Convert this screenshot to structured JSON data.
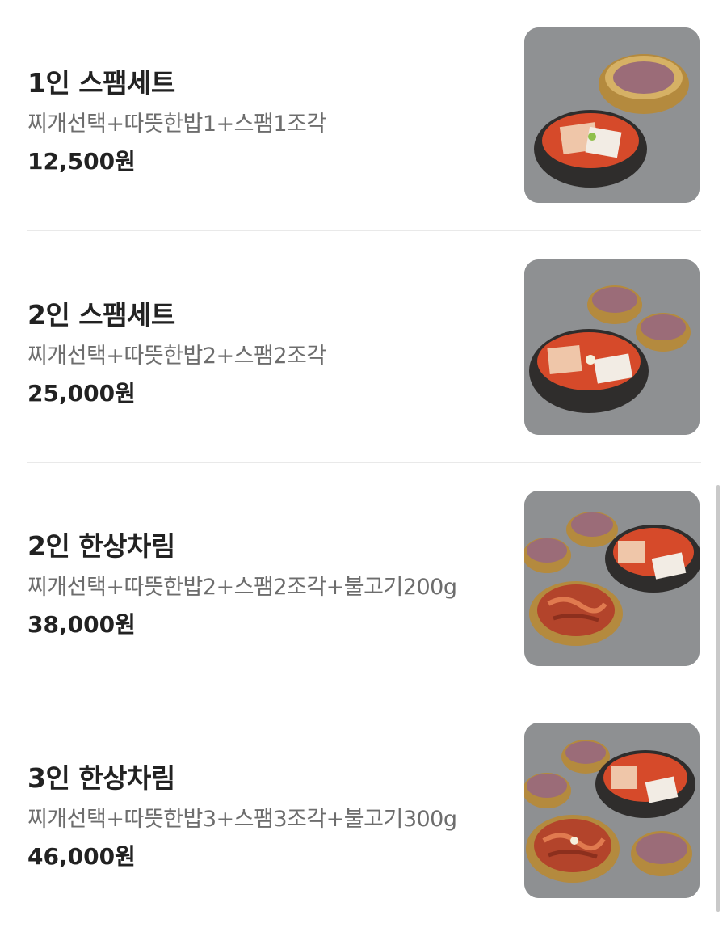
{
  "menu": {
    "items": [
      {
        "name": "1인 스팸세트",
        "description": "찌개선택+따뜻한밥1+스팸1조각",
        "price": "12,500원",
        "photo_icon": "spam-stew-set-1-photo"
      },
      {
        "name": "2인 스팸세트",
        "description": "찌개선택+따뜻한밥2+스팸2조각",
        "price": "25,000원",
        "photo_icon": "spam-stew-set-2-photo"
      },
      {
        "name": "2인 한상차림",
        "description": "찌개선택+따뜻한밥2+스팸2조각+불고기200g",
        "price": "38,000원",
        "photo_icon": "full-table-2-photo"
      },
      {
        "name": "3인 한상차림",
        "description": "찌개선택+따뜻한밥3+스팸3조각+불고기300g",
        "price": "46,000원",
        "photo_icon": "full-table-3-photo"
      }
    ]
  },
  "colors": {
    "text_primary": "#222222",
    "text_secondary": "#6d6d6d",
    "divider": "#e9e9e9",
    "photo_background": "#8e9092"
  }
}
